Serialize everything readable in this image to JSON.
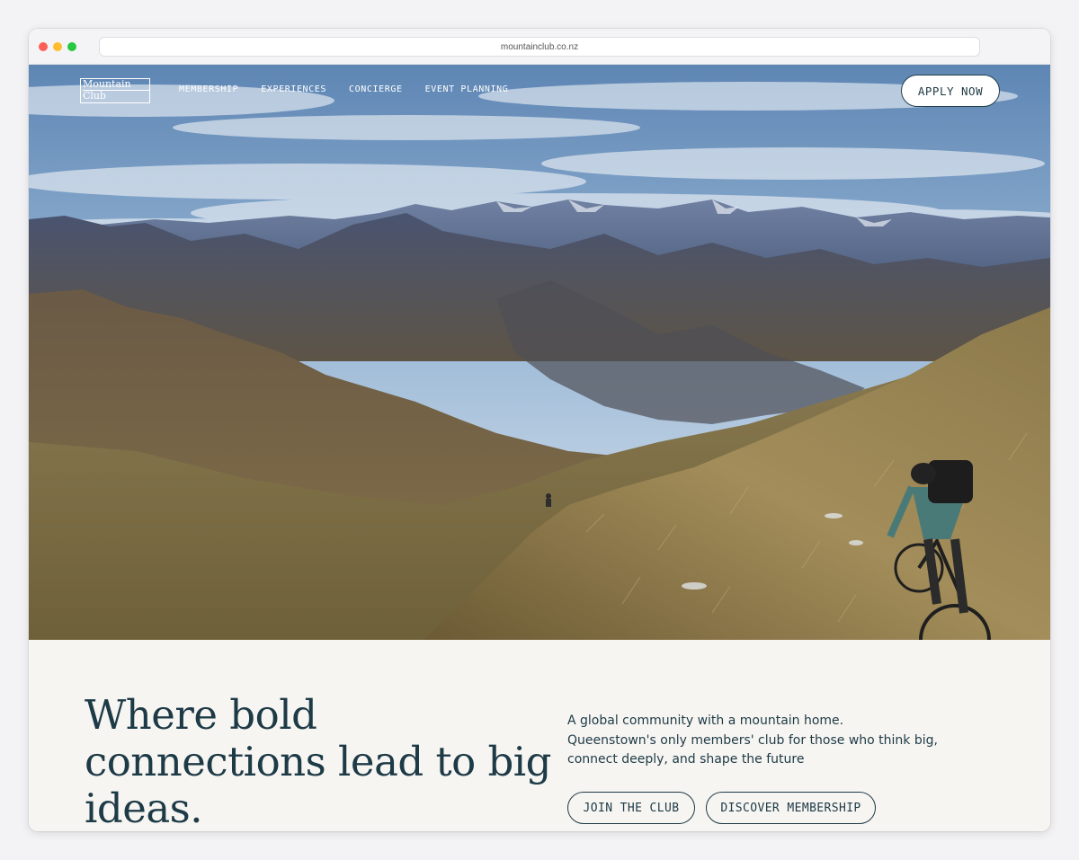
{
  "browser": {
    "url": "mountainclub.co.nz"
  },
  "nav": {
    "logo_line1": "Mountain",
    "logo_line2": "Club",
    "links": [
      "MEMBERSHIP",
      "EXPERIENCES",
      "CONCIERGE",
      "EVENT PLANNING"
    ],
    "apply_label": "APPLY NOW"
  },
  "hero": {
    "image": "mountain-biker-hero-photo"
  },
  "main": {
    "headline": "Where bold connections lead to big ideas.",
    "intro_line1": "A global community with a mountain home.",
    "intro_line2": "Queenstown's only members' club for those who think big, connect deeply, and shape the future",
    "join_label": "JOIN THE CLUB",
    "discover_label": "DISCOVER MEMBERSHIP"
  },
  "colors": {
    "text_primary": "#1d3a47",
    "background": "#f7f5f1"
  }
}
